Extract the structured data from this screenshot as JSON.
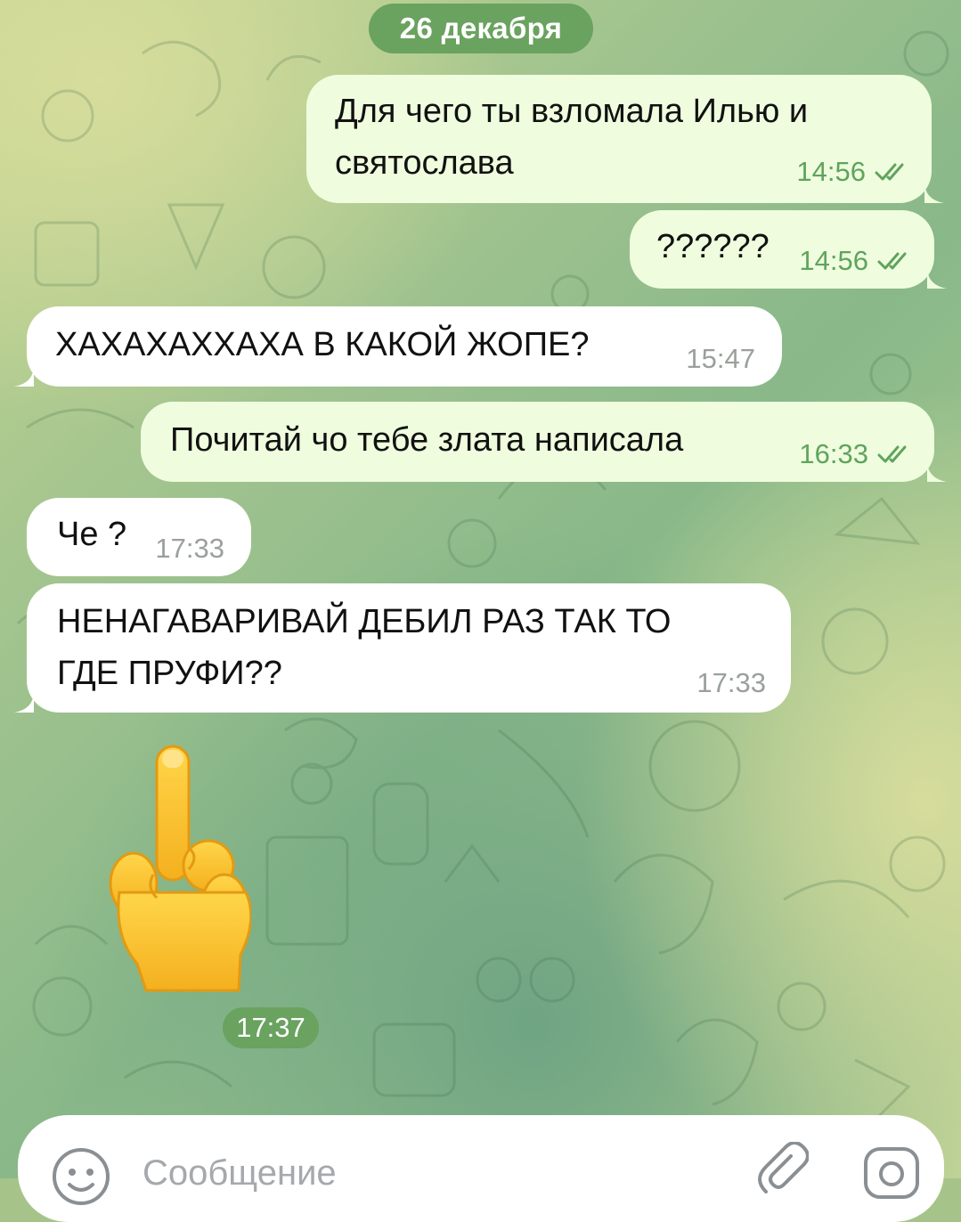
{
  "date_separator": "26 декабря",
  "messages": [
    {
      "direction": "out",
      "lines": [
        "Для чего ты взломала Илью и",
        "святослава"
      ],
      "time": "14:56",
      "status": "read"
    },
    {
      "direction": "out",
      "lines": [
        "??????"
      ],
      "time": "14:56",
      "status": "read"
    },
    {
      "direction": "in",
      "lines": [
        "ХАХАХАХХАХА В КАКОЙ ЖОПЕ?"
      ],
      "time": "15:47"
    },
    {
      "direction": "out",
      "lines": [
        "Почитай чо тебе злата написала"
      ],
      "time": "16:33",
      "status": "read"
    },
    {
      "direction": "in",
      "lines": [
        "Че ?"
      ],
      "time": "17:33"
    },
    {
      "direction": "in",
      "lines": [
        "НЕНАГАВАРИВАЙ ДЕБИЛ РАЗ ТАК ТО",
        "ГДЕ ПРУФИ??"
      ],
      "time": "17:33"
    },
    {
      "direction": "in",
      "type": "sticker",
      "sticker": "middle-finger-emoji",
      "time": "17:37"
    }
  ],
  "composer": {
    "placeholder": "Сообщение",
    "value": "",
    "left_icon": "emoji-smile-icon",
    "right_icons": [
      "paperclip-icon",
      "camera-icon"
    ]
  },
  "colors": {
    "outgoing_bubble": "#effdde",
    "incoming_bubble": "#ffffff",
    "outgoing_time": "#5fa45d",
    "incoming_time": "#9aa09b",
    "service_pill": "#6aa25f",
    "sticker_skin": "#ffc83d"
  }
}
